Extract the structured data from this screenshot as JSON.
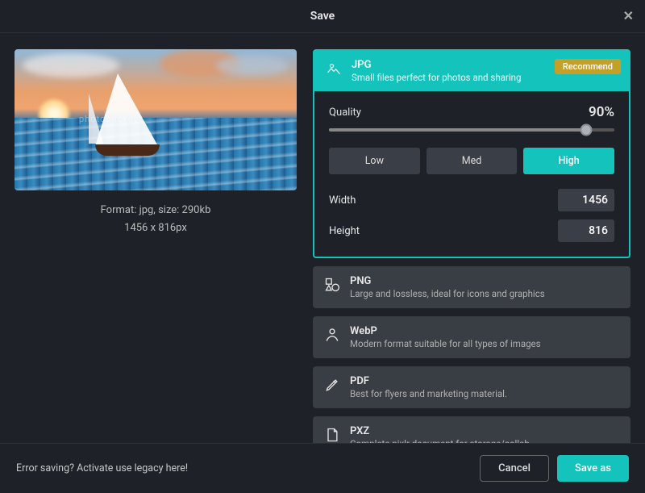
{
  "header": {
    "title": "Save"
  },
  "preview": {
    "format_line": "Format: jpg, size: 290kb",
    "dims_line": "1456 x 816px",
    "watermark": "photobucket"
  },
  "format_selected": {
    "title": "JPG",
    "subtitle": "Small files perfect for photos and sharing",
    "badge": "Recommend",
    "quality_label": "Quality",
    "quality_value": "90%",
    "presets": {
      "low": "Low",
      "med": "Med",
      "high": "High"
    },
    "width_label": "Width",
    "width_value": "1456",
    "height_label": "Height",
    "height_value": "816"
  },
  "formats": [
    {
      "title": "PNG",
      "subtitle": "Large and lossless, ideal for icons and graphics"
    },
    {
      "title": "WebP",
      "subtitle": "Modern format suitable for all types of images"
    },
    {
      "title": "PDF",
      "subtitle": "Best for flyers and marketing material."
    },
    {
      "title": "PXZ",
      "subtitle": "Complete pixlr document for storage/collab"
    }
  ],
  "footer": {
    "legacy": "Error saving? Activate use legacy here!",
    "cancel": "Cancel",
    "save_as": "Save as"
  }
}
